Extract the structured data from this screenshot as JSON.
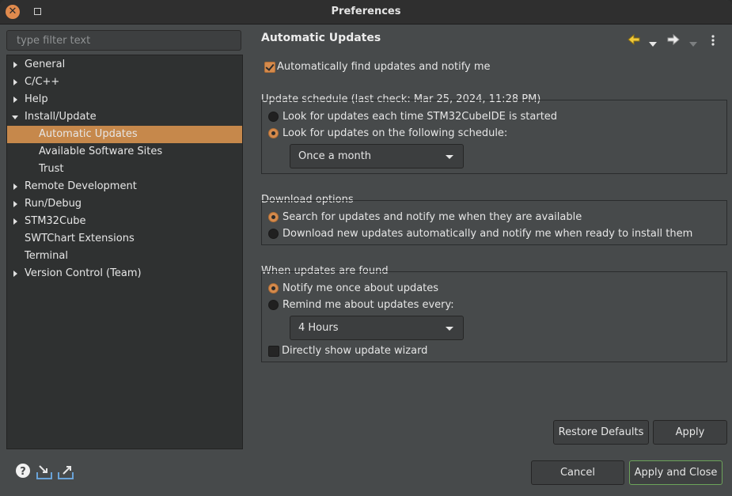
{
  "window": {
    "title": "Preferences"
  },
  "filter": {
    "placeholder": "type filter text"
  },
  "tree": [
    {
      "label": "General",
      "expander": "right"
    },
    {
      "label": "C/C++",
      "expander": "right"
    },
    {
      "label": "Help",
      "expander": "right"
    },
    {
      "label": "Install/Update",
      "expander": "down"
    },
    {
      "label": "Automatic Updates",
      "child": true,
      "selected": true
    },
    {
      "label": "Available Software Sites",
      "child": true
    },
    {
      "label": "Trust",
      "child": true
    },
    {
      "label": "Remote Development",
      "expander": "right"
    },
    {
      "label": "Run/Debug",
      "expander": "right"
    },
    {
      "label": "STM32Cube",
      "expander": "right"
    },
    {
      "label": "SWTChart Extensions"
    },
    {
      "label": "Terminal"
    },
    {
      "label": "Version Control (Team)",
      "expander": "right"
    }
  ],
  "page": {
    "title": "Automatic Updates",
    "auto_find": {
      "label": "Automatically find updates and notify me",
      "checked": true
    },
    "schedule": {
      "title": "Update schedule (last check: Mar 25, 2024, 11:28 PM)",
      "option_start": "Look for updates each time STM32CubeIDE is started",
      "option_schedule": "Look for updates on the following schedule:",
      "selected": "schedule",
      "frequency": "Once a month"
    },
    "download": {
      "title": "Download options",
      "option_search": "Search for updates and notify me when they are available",
      "option_auto": "Download new updates automatically and notify me when ready to install them",
      "selected": "search"
    },
    "found": {
      "title": "When updates are found",
      "option_once": "Notify me once about updates",
      "option_remind": "Remind me about updates every:",
      "selected": "once",
      "remind_interval": "4 Hours",
      "wizard_label": "Directly show update wizard",
      "wizard_checked": false
    }
  },
  "buttons": {
    "restore": "Restore Defaults",
    "apply": "Apply",
    "cancel": "Cancel",
    "apply_close": "Apply and Close"
  },
  "colors": {
    "accent": "#d58a4c",
    "selection": "#c6884b",
    "default_button_border": "#6ca35a"
  }
}
